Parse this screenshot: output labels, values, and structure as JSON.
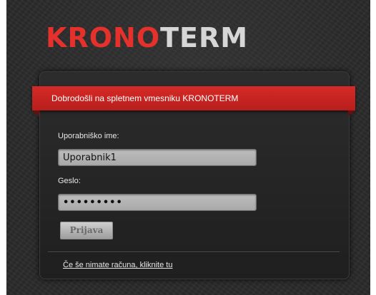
{
  "brand": {
    "logo_part1": "KRONO",
    "logo_part2": "TERM",
    "accent_color": "#e4312b"
  },
  "banner": {
    "welcome_text": "Dobrodošli na spletnem vmesniku KRONOTERM"
  },
  "login_form": {
    "username_label": "Uporabniško ime:",
    "username_value": "Uporabnik1",
    "password_label": "Geslo:",
    "password_value": "•••••••••",
    "submit_label": "Prijava"
  },
  "footer": {
    "register_link": "Če še nimate računa, kliknite tu"
  }
}
